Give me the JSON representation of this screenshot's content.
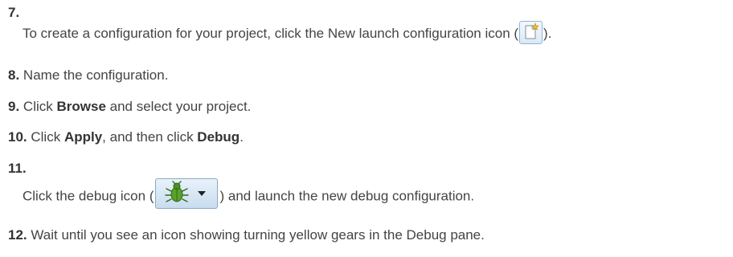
{
  "steps": [
    {
      "number": "7.",
      "text_before": "To create a configuration for your project, click the New launch configuration icon (",
      "text_after": ")."
    },
    {
      "number": "8.",
      "text": "Name the configuration."
    },
    {
      "number": "9.",
      "text_before": "Click ",
      "bold": "Browse",
      "text_after": " and select your project."
    },
    {
      "number": "10.",
      "text_before": "Click ",
      "bold1": "Apply",
      "text_middle": ", and then click ",
      "bold2": "Debug",
      "text_after": "."
    },
    {
      "number": "11.",
      "text_before": "Click the debug icon (",
      "text_after": ") and launch the new debug configuration."
    },
    {
      "number": "12.",
      "text": "Wait until you see an icon showing turning yellow gears in the Debug pane."
    }
  ],
  "icons": {
    "new_launch_configuration": "new-launch-configuration-icon",
    "debug": "debug-bug-icon",
    "dropdown": "chevron-down-icon"
  }
}
